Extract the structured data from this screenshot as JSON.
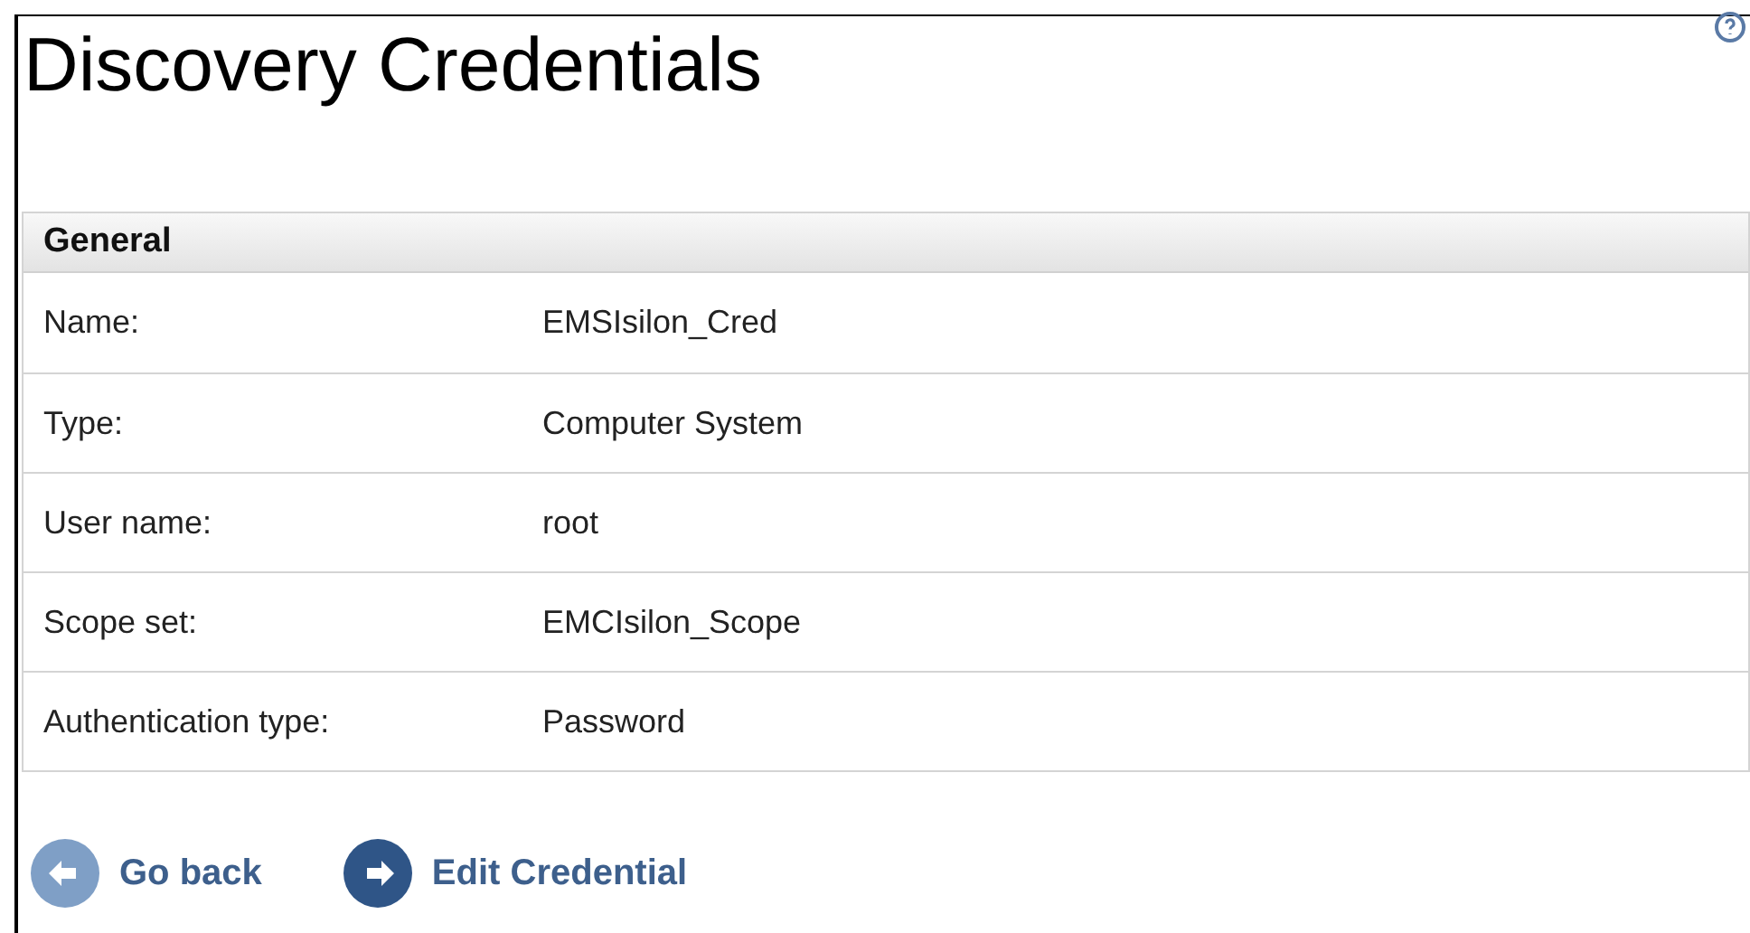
{
  "title": "Discovery Credentials",
  "section": {
    "title": "General",
    "rows": [
      {
        "label": "Name:",
        "value": "EMSIsilon_Cred"
      },
      {
        "label": "Type:",
        "value": "Computer System"
      },
      {
        "label": "User name:",
        "value": "root"
      },
      {
        "label": "Scope set:",
        "value": "EMCIsilon_Scope"
      },
      {
        "label": "Authentication type:",
        "value": "Password"
      }
    ]
  },
  "buttons": [
    {
      "label": "Go back",
      "kind": "back"
    },
    {
      "label": "Edit Credential",
      "kind": "forward"
    }
  ]
}
